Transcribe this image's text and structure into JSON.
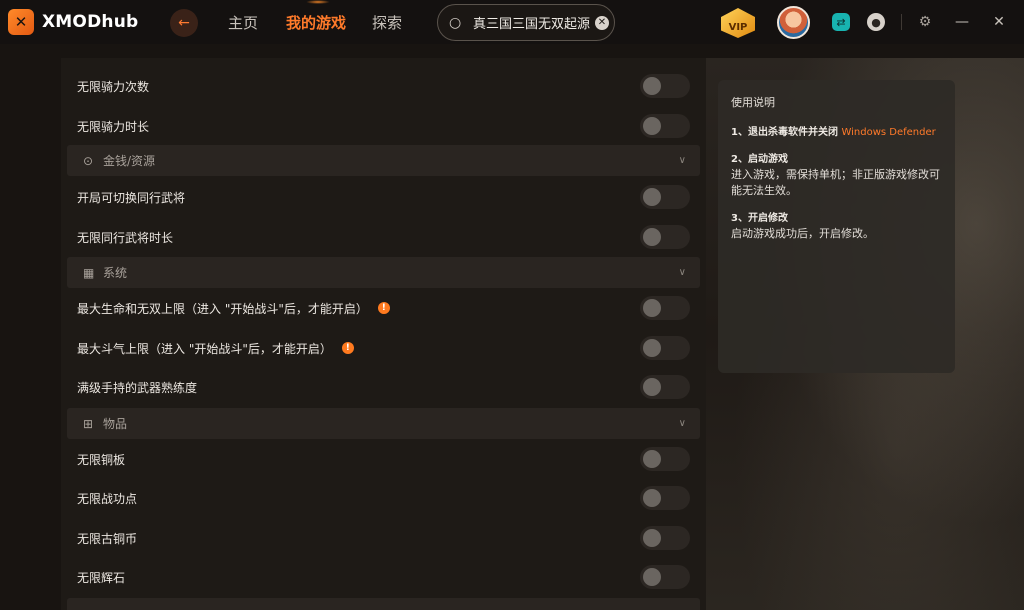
{
  "app": {
    "logo_mark": "✕",
    "name_part1": "XMOD",
    "name_part2": "hub"
  },
  "nav": {
    "back_icon": "arrow-left-icon",
    "home": "主页",
    "my_games": "我的游戏",
    "explore": "探索"
  },
  "search": {
    "value": "真三国三国无双起源",
    "placeholder": ""
  },
  "header_right": {
    "vip_label": "VIP"
  },
  "list": {
    "rows": [
      {
        "label": "无限骑力次数"
      },
      {
        "label": "无限骑力时长"
      }
    ],
    "section_money": {
      "label": "金钱/资源"
    },
    "money_rows": [
      {
        "label": "开局可切换同行武将"
      },
      {
        "label": "无限同行武将时长"
      }
    ],
    "section_system": {
      "label": "系统"
    },
    "system_rows": [
      {
        "label": "最大生命和无双上限（进入 \"开始战斗\"后，才能开启）",
        "info": "!"
      },
      {
        "label": "最大斗气上限（进入 \"开始战斗\"后，才能开启）",
        "info": "!"
      },
      {
        "label": "满级手持的武器熟练度"
      }
    ],
    "section_items": {
      "label": "物品"
    },
    "item_rows": [
      {
        "label": "无限铜板"
      },
      {
        "label": "无限战功点"
      },
      {
        "label": "无限古铜币"
      },
      {
        "label": "无限辉石"
      }
    ]
  },
  "instructions": {
    "title": "使用说明",
    "step1_head": "1、退出杀毒软件并关闭",
    "step1_accent": "Windows Defender",
    "step2_head": "2、启动游戏",
    "step2_body": "进入游戏，需保持单机；非正版游戏修改可能无法生效。",
    "step3_head": "3、开启修改",
    "step3_body": "启动游戏成功后，开启修改。"
  },
  "colors": {
    "accent": "#ff7a2a",
    "background": "#181411",
    "panel": "#1e1a16",
    "section": "#2a2521"
  }
}
